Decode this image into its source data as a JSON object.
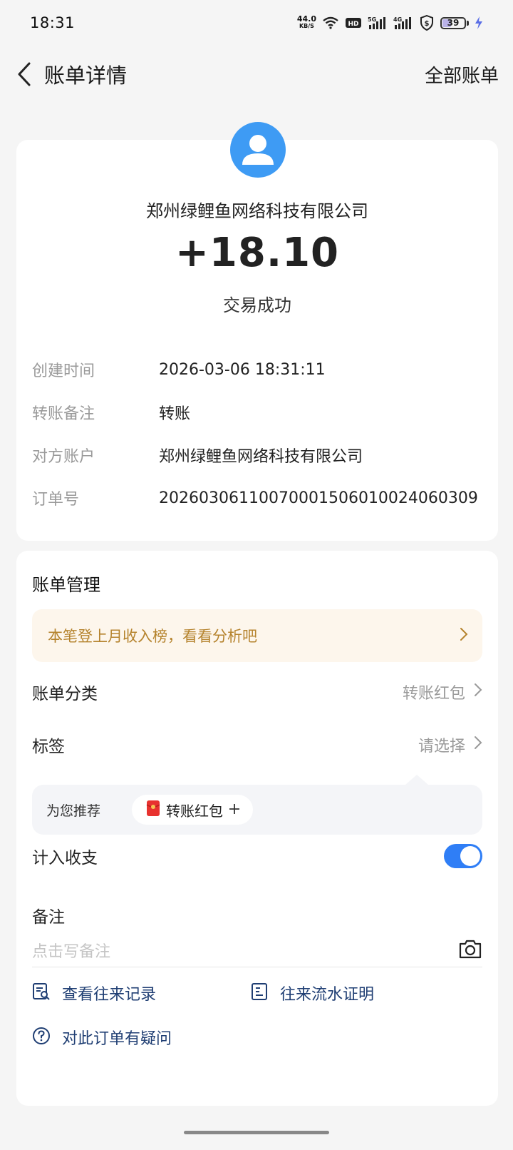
{
  "status_bar": {
    "time": "18:31",
    "net_speed": "44.0",
    "net_unit": "KB/S",
    "battery": "39",
    "battery_level": 0.39
  },
  "header": {
    "back_icon": "chevron-left-icon",
    "title": "账单详情",
    "all_bills": "全部账单"
  },
  "summary": {
    "avatar_icon": "user-avatar-icon",
    "merchant": "郑州绿鲤鱼网络科技有限公司",
    "amount": "+18.10",
    "status": "交易成功",
    "details": [
      {
        "label": "创建时间",
        "value": "2026-03-06 18:31:11"
      },
      {
        "label": "转账备注",
        "value": "转账"
      },
      {
        "label": "对方账户",
        "value": "郑州绿鲤鱼网络科技有限公司"
      },
      {
        "label": "订单号",
        "value": "20260306110070001506010024060309"
      }
    ]
  },
  "manage": {
    "title": "账单管理",
    "promo": "本笔登上月收入榜，看看分析吧",
    "category_label": "账单分类",
    "category_value": "转账红包",
    "tag_label": "标签",
    "tag_value": "请选择",
    "recommend_label": "为您推荐",
    "recommend_chip": "转账红包",
    "income_label": "计入收支",
    "income_on": true,
    "note_label": "备注",
    "note_placeholder": "点击写备注",
    "link_history": "查看往来记录",
    "link_proof": "往来流水证明",
    "link_question": "对此订单有疑问"
  },
  "colors": {
    "accent": "#2f7ef6",
    "avatar_bg": "#3e9bf4",
    "promo_text": "#b5832d",
    "link": "#1f3e73"
  }
}
